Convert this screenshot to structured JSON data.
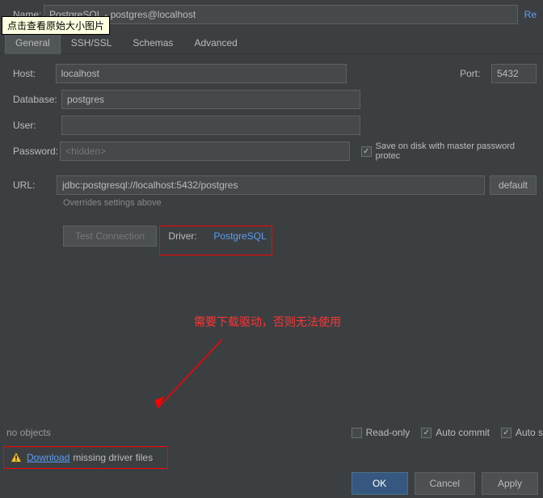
{
  "name": {
    "label": "Name:",
    "value": "PostgreSQL - postgres@localhost",
    "reset": "Re"
  },
  "tooltip": "点击查看原始大小图片",
  "tabs": {
    "general": "General",
    "sshssl": "SSH/SSL",
    "schemas": "Schemas",
    "advanced": "Advanced"
  },
  "host": {
    "label": "Host:",
    "value": "localhost"
  },
  "port": {
    "label": "Port:",
    "value": "5432"
  },
  "database": {
    "label": "Database:",
    "value": "postgres"
  },
  "user": {
    "label": "User:",
    "value": ""
  },
  "password": {
    "label": "Password:",
    "placeholder": "<hidden>"
  },
  "saveOnDisk": "Save on disk with master password protec",
  "url": {
    "label": "URL:",
    "value": "jdbc:postgresql://localhost:5432/postgres",
    "default": "default",
    "hint": "Overrides settings above"
  },
  "testConnection": "Test Connection",
  "driver": {
    "label": "Driver:",
    "value": "PostgreSQL"
  },
  "annotation": "需要下载驱动，否则无法使用",
  "noObjects": "no objects",
  "options": {
    "readonly": "Read-only",
    "autocommit": "Auto commit",
    "autosync": "Auto s"
  },
  "download": {
    "link": "Download",
    "rest": "missing driver files"
  },
  "buttons": {
    "ok": "OK",
    "cancel": "Cancel",
    "apply": "Apply"
  }
}
